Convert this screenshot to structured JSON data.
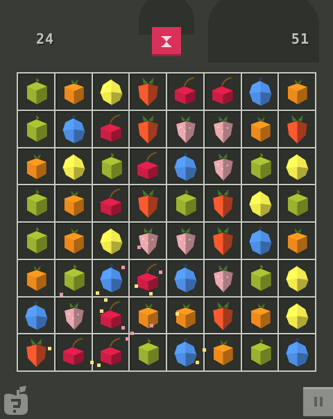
{
  "hud": {
    "moves": "24",
    "score": "51",
    "timer_icon": "hourglass-icon",
    "accent": "#d8325a"
  },
  "board": {
    "rows": 8,
    "cols": 8,
    "cells": [
      [
        "lime",
        "orange",
        "lemon",
        "carrot",
        "cherry",
        "cherry",
        "berry",
        "orange"
      ],
      [
        "lime",
        "berry",
        "cherry",
        "carrot",
        "strawberry",
        "strawberry",
        "orange",
        "carrot"
      ],
      [
        "orange",
        "lemon",
        "lime",
        "cherry",
        "berry",
        "strawberry",
        "lime",
        "lemon"
      ],
      [
        "lime",
        "orange",
        "cherry",
        "carrot",
        "lime",
        "carrot",
        "lemon",
        "lime"
      ],
      [
        "lime",
        "orange",
        "lemon",
        "strawberry",
        "strawberry",
        "carrot",
        "berry",
        "orange"
      ],
      [
        "orange",
        "lime",
        "berry",
        "cherry",
        "berry",
        "strawberry",
        "lime",
        "lemon"
      ],
      [
        "berry",
        "strawberry",
        "cherry",
        "orange",
        "orange",
        "carrot",
        "orange",
        "lemon"
      ],
      [
        "carrot",
        "cherry",
        "cherry",
        "lime",
        "berry",
        "orange",
        "lime",
        "berry"
      ]
    ]
  },
  "fruit_colors": {
    "lime": "#9ab22f",
    "orange": "#ee8a1c",
    "lemon": "#f1ea4e",
    "carrot": "#e0502a",
    "cherry": "#cc1d45",
    "strawberry": "#ecaab0",
    "berry": "#4e8fe6"
  },
  "controls": {
    "hint_icon": "apple-question-icon",
    "pause_icon": "pause-icon"
  }
}
